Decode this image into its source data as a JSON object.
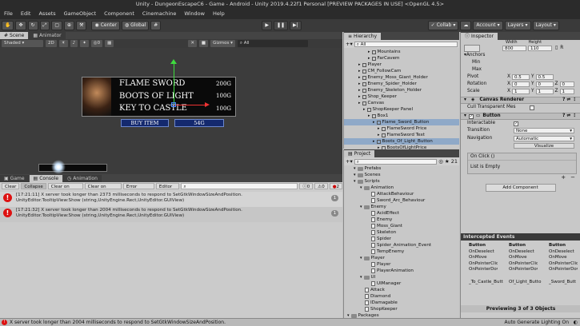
{
  "window": {
    "title": "Unity - DungeonEscapeC6 - Game - Android - Unity 2019.4.22f1 Personal [PREVIEW PACKAGES IN USE] <OpenGL 4.5>"
  },
  "menu": [
    "File",
    "Edit",
    "Assets",
    "GameObject",
    "Component",
    "Cinemachine",
    "Window",
    "Help"
  ],
  "toolbar": {
    "center": "Center",
    "global": "Global",
    "collab": "Collab",
    "account": "Account",
    "layers": "Layers",
    "layout": "Layout"
  },
  "scene_tabs": [
    {
      "label": "Scene"
    },
    {
      "label": "Animator"
    }
  ],
  "scene_toolbar": {
    "shading": "Shaded",
    "mode2d": "2D",
    "gizmos": "Gizmos",
    "search_placeholder": "All",
    "count": "0"
  },
  "scene": {
    "items": [
      {
        "name": "FLAME SWORD",
        "price": "200G"
      },
      {
        "name": "BOOTS OF LIGHT",
        "price": "100G"
      },
      {
        "name": "KEY TO CASTLE",
        "price": "100G"
      }
    ],
    "buy_label": "BUY ITEM",
    "gold_label": "54G"
  },
  "console_tabs": [
    {
      "label": "Game"
    },
    {
      "label": "Console"
    },
    {
      "label": "Animation"
    }
  ],
  "console_toolbar": {
    "clear": "Clear",
    "collapse": "Collapse",
    "clear_on_play": "Clear on Play",
    "clear_on_build": "Clear on Build",
    "error_pause": "Error Pause",
    "editor": "Editor",
    "count_info": "0",
    "count_warn": "0",
    "count_err": "2"
  },
  "logs": [
    {
      "line1": "[17:21:11] X server took longer than 2373 milliseconds to respond to SetGtkWindowSizeAndPosition.",
      "line2": "UnityEditor.TooltipView:Show (string,UnityEngine.Rect,UnityEditor.GUIView)",
      "count": "1"
    },
    {
      "line1": "[17:21:32] X server took longer than 2004 milliseconds to respond to SetGtkWindowSizeAndPosition.",
      "line2": "UnityEditor.TooltipView:Show (string,UnityEngine.Rect,UnityEditor.GUIView)",
      "count": "1"
    }
  ],
  "hierarchy": {
    "title": "Hierarchy",
    "search_placeholder": "All",
    "items": [
      {
        "label": "Mountains",
        "indent": 5,
        "kind": "cube"
      },
      {
        "label": "FarCavem",
        "indent": 5,
        "kind": "cube"
      },
      {
        "label": "Player",
        "indent": 3,
        "kind": "cube"
      },
      {
        "label": "CM_FollowCam",
        "indent": 3,
        "kind": "cube"
      },
      {
        "label": "Enemy_Moss_Giant_Holder",
        "indent": 3,
        "kind": "cube"
      },
      {
        "label": "Enemy_Spider_Holder",
        "indent": 3,
        "kind": "cube"
      },
      {
        "label": "Enemy_Skeleton_Holder",
        "indent": 3,
        "kind": "cube"
      },
      {
        "label": "Shop_Keeper",
        "indent": 3,
        "kind": "cube"
      },
      {
        "label": "Canvas",
        "indent": 3,
        "kind": "cube"
      },
      {
        "label": "ShopKeeper Panel",
        "indent": 4,
        "kind": "cube"
      },
      {
        "label": "Box1",
        "indent": 5,
        "kind": "cube"
      },
      {
        "label": "Flame_Sword_Button",
        "indent": 6,
        "kind": "cube",
        "selected": true
      },
      {
        "label": "FlameSword Price",
        "indent": 7,
        "kind": "cube"
      },
      {
        "label": "FlameSword Text",
        "indent": 7,
        "kind": "cube"
      },
      {
        "label": "Boots_Of_Light_Button",
        "indent": 6,
        "kind": "cube",
        "selected": true
      },
      {
        "label": "BootsOfLightPrice",
        "indent": 7,
        "kind": "cube"
      }
    ]
  },
  "project": {
    "title": "Project",
    "count": "21",
    "items": [
      {
        "label": "Prefabs",
        "indent": 1,
        "kind": "folder"
      },
      {
        "label": "Scenes",
        "indent": 1,
        "kind": "folder"
      },
      {
        "label": "Scripts",
        "indent": 1,
        "kind": "folder"
      },
      {
        "label": "Animation",
        "indent": 2,
        "kind": "folder"
      },
      {
        "label": "AttackBehaviour",
        "indent": 3,
        "kind": "file"
      },
      {
        "label": "Sword_Arc_Behaviour",
        "indent": 3,
        "kind": "file"
      },
      {
        "label": "Enemy",
        "indent": 2,
        "kind": "folder"
      },
      {
        "label": "AcidEffect",
        "indent": 3,
        "kind": "file"
      },
      {
        "label": "Enemy",
        "indent": 3,
        "kind": "file"
      },
      {
        "label": "Moss_Giant",
        "indent": 3,
        "kind": "file"
      },
      {
        "label": "Skeleton",
        "indent": 3,
        "kind": "file"
      },
      {
        "label": "Spider",
        "indent": 3,
        "kind": "file"
      },
      {
        "label": "Spider_Animation_Event",
        "indent": 3,
        "kind": "file"
      },
      {
        "label": "TempEnemy",
        "indent": 3,
        "kind": "file"
      },
      {
        "label": "Player",
        "indent": 2,
        "kind": "folder"
      },
      {
        "label": "Player",
        "indent": 3,
        "kind": "file"
      },
      {
        "label": "PlayerAnimation",
        "indent": 3,
        "kind": "file"
      },
      {
        "label": "UI",
        "indent": 2,
        "kind": "folder"
      },
      {
        "label": "UIManager",
        "indent": 3,
        "kind": "file"
      },
      {
        "label": "Attack",
        "indent": 2,
        "kind": "file"
      },
      {
        "label": "Diamond",
        "indent": 2,
        "kind": "file"
      },
      {
        "label": "IDamagable",
        "indent": 2,
        "kind": "file"
      },
      {
        "label": "ShopKeeper",
        "indent": 2,
        "kind": "file"
      },
      {
        "label": "Packages",
        "indent": 0,
        "kind": "folder"
      }
    ]
  },
  "inspector": {
    "title": "Inspector",
    "width_label": "Width",
    "height_label": "Height",
    "width": "800",
    "height": "110",
    "anchors": "Anchors",
    "min": "Min",
    "max": "Max",
    "pivot": "Pivot",
    "pivot_x": "0.5",
    "pivot_y": "0.5",
    "rotation": "Rotation",
    "rot_x": "0",
    "rot_y": "0",
    "rot_z": "0",
    "scale": "Scale",
    "scale_x": "1",
    "scale_y": "1",
    "scale_z": "1",
    "x": "X",
    "y": "Y",
    "z": "Z",
    "canvas_renderer": "Canvas Renderer",
    "cull": "Cull Transparent Mes",
    "button": "Button",
    "interactable": "Interactable",
    "transition": "Transition",
    "transition_val": "None",
    "navigation": "Navigation",
    "navigation_val": "Automatic",
    "visualize": "Visualize",
    "on_click": "On Click ()",
    "list_empty": "List is Empty",
    "add_component": "Add Component"
  },
  "events": {
    "title": "Intercepted Events",
    "columns": [
      {
        "header": "Button",
        "items": [
          "OnDeselect",
          "OnMove",
          "OnPointerClic",
          "OnPointerDov"
        ],
        "footer": "_To_Castle_Butt"
      },
      {
        "header": "Button",
        "items": [
          "OnDeselect",
          "OnMove",
          "OnPointerClic",
          "OnPointerDov"
        ],
        "footer": "Of_Light_Butto"
      },
      {
        "header": "Button",
        "items": [
          "OnDeselect",
          "OnMove",
          "OnPointerClic",
          "OnPointerDov"
        ],
        "footer": "_Sword_Butt"
      }
    ],
    "previewing": "Previewing 3 of 3 Objects"
  },
  "status": {
    "message": "X server took longer than 2004 milliseconds to respond to SetGtkWindowSizeAndPosition.",
    "right": "Auto Generate Lighting On"
  }
}
